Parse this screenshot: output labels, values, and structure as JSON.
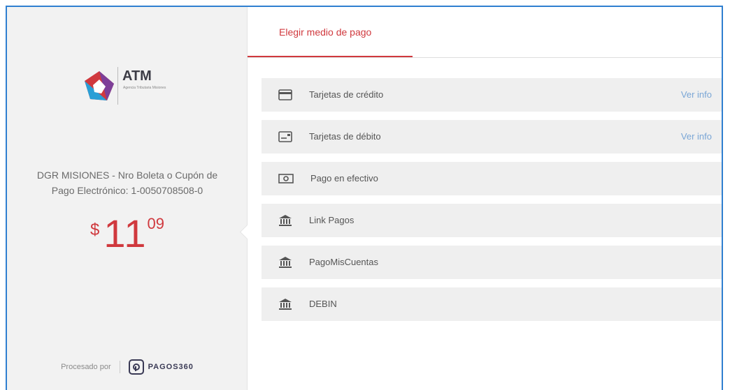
{
  "brand": {
    "name": "ATM",
    "subtitle": "Agencia Tributaria Misiones",
    "accent": "#d0393e",
    "frame_color": "#2f7fd0"
  },
  "payment": {
    "description_line1": "DGR MISIONES - Nro Boleta o Cupón de",
    "description_line2": "Pago Electrónico: 1-0050708508-0",
    "currency": "$",
    "amount_integer": "11",
    "amount_decimal": "09"
  },
  "footer": {
    "processed_by": "Procesado por",
    "provider": "PAGOS360"
  },
  "tabs": [
    {
      "label": "Elegir medio de pago",
      "active": true
    }
  ],
  "methods": [
    {
      "label": "Tarjetas de crédito",
      "icon": "credit-card-icon",
      "info": "Ver info"
    },
    {
      "label": "Tarjetas de débito",
      "icon": "debit-card-icon",
      "info": "Ver info"
    },
    {
      "label": "Pago en efectivo",
      "icon": "cash-icon",
      "info": ""
    },
    {
      "label": "Link Pagos",
      "icon": "bank-icon",
      "info": ""
    },
    {
      "label": "PagoMisCuentas",
      "icon": "bank-icon",
      "info": ""
    },
    {
      "label": "DEBIN",
      "icon": "bank-icon",
      "info": ""
    }
  ]
}
